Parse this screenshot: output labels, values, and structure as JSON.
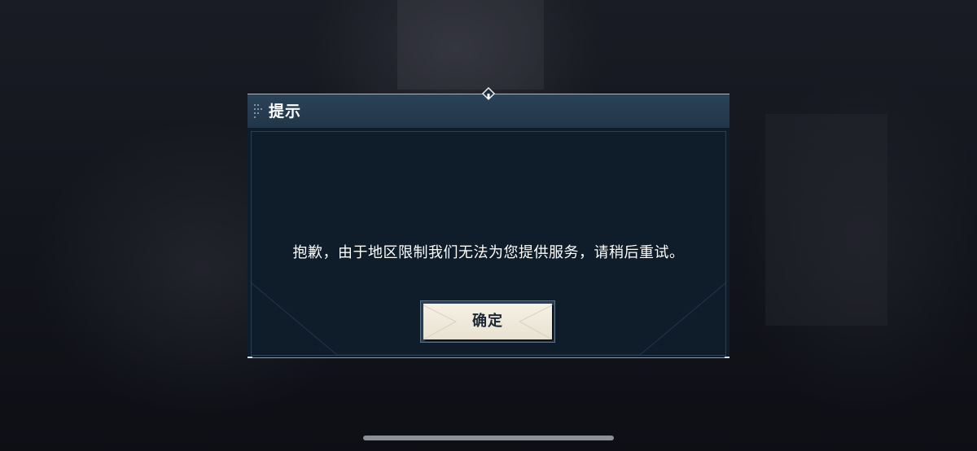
{
  "dialog": {
    "title": "提示",
    "message": "抱歉，由于地区限制我们无法为您提供服务，请稍后重试。",
    "confirm_label": "确定"
  },
  "icons": {
    "title_grip": "grip-dots-icon",
    "top_ornament": "diamond-ornament-icon"
  },
  "colors": {
    "title_bar": "#2b4257",
    "body": "#0f1c2a",
    "button_face": "#f6f1e5",
    "text": "#ffffff"
  }
}
